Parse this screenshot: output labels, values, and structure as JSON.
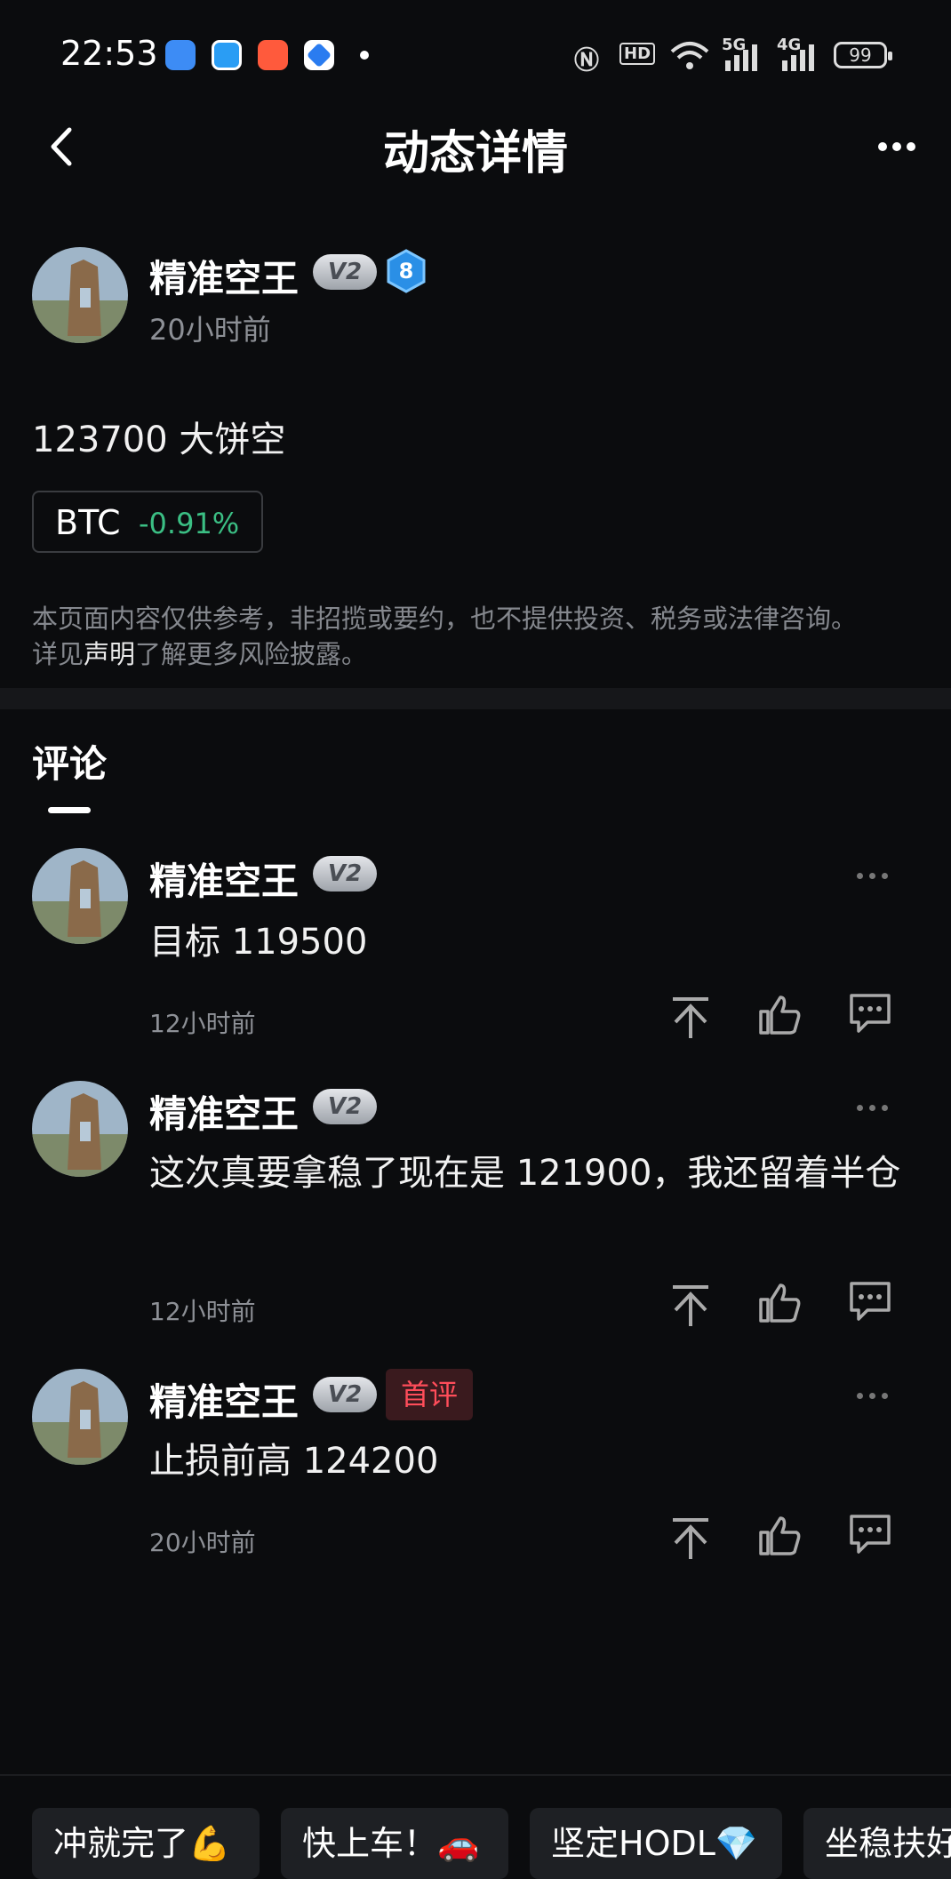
{
  "status_bar": {
    "time": "22:53",
    "network_5g": "5G",
    "network_4g": "4G",
    "hd": "HD",
    "battery": "99"
  },
  "header": {
    "title": "动态详情"
  },
  "post": {
    "author": "精准空王",
    "badge": "V2",
    "level": "8",
    "time": "20小时前",
    "content": "123700 大饼空",
    "ticker": {
      "symbol": "BTC",
      "change": "-0.91%"
    },
    "disclaimer_line1": "本页面内容仅供参考，非招揽或要约，也不提供投资、税务或法律咨询。",
    "disclaimer_prefix": "详见",
    "disclaimer_link": "声明",
    "disclaimer_suffix": "了解更多风险披露。"
  },
  "comments_section": {
    "title": "评论",
    "items": [
      {
        "author": "精准空王",
        "badge": "V2",
        "text": "目标 119500",
        "time": "12小时前",
        "extra_badge": ""
      },
      {
        "author": "精准空王",
        "badge": "V2",
        "text": "这次真要拿稳了现在是 121900，我还留着半仓",
        "time": "12小时前",
        "extra_badge": ""
      },
      {
        "author": "精准空王",
        "badge": "V2",
        "text": "止损前高 124200",
        "time": "20小时前",
        "extra_badge": "首评"
      }
    ]
  },
  "quick_replies": [
    "冲就完了💪",
    "快上车！🚗",
    "坚定HODL💎",
    "坐稳扶好"
  ],
  "colors": {
    "background": "#0b0c0e",
    "positive": "#3bbf84",
    "first_badge": "#ff4d5a"
  }
}
